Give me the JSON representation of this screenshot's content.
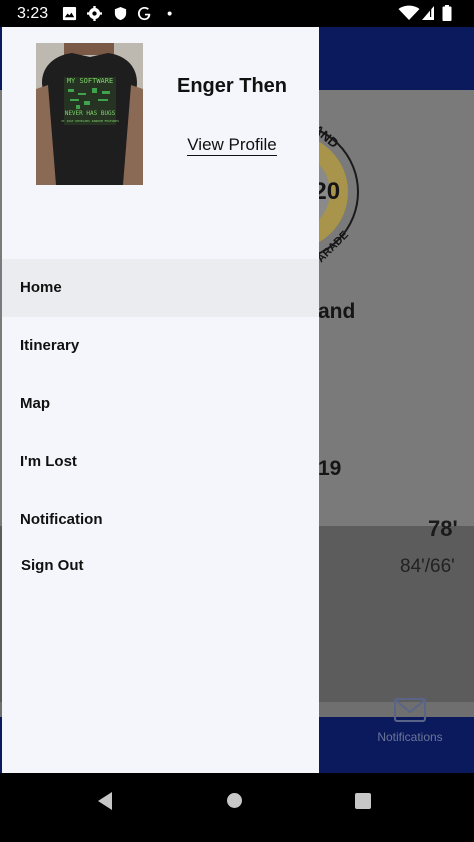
{
  "status_bar": {
    "time": "3:23",
    "left_icons": [
      "gallery-icon",
      "settings-icon",
      "shield-icon",
      "google-icon",
      "dot-icon"
    ],
    "right_icons": [
      "wifi-icon",
      "signal-icon",
      "battery-icon"
    ]
  },
  "drawer": {
    "profile": {
      "name": "Enger Then",
      "view_profile_label": "View Profile",
      "shirt_text": [
        "MY SOFTWARE",
        "NEVER HAS BUGS",
        "IT JUST DEVELOPS RANDOM FEATURES"
      ]
    },
    "menu": [
      {
        "label": "Home",
        "active": true
      },
      {
        "label": "Itinerary",
        "active": false
      },
      {
        "label": "Map",
        "active": false
      },
      {
        "label": "I'm Lost",
        "active": false
      },
      {
        "label": "Notification",
        "active": false
      },
      {
        "label": "Sign Out",
        "active": false
      }
    ]
  },
  "background_app": {
    "logo_fragment": [
      "AND",
      "020",
      "PARADE"
    ],
    "heading_fragment": "and",
    "date_fragment": "19",
    "stat_primary": "78'",
    "stat_secondary": "84'/66'",
    "tab_notifications_label": "Notifications"
  },
  "colors": {
    "drawer_bg": "#f5f6fb",
    "active_item_bg": "#ebecf0",
    "app_bar": "#0a1a5c"
  }
}
